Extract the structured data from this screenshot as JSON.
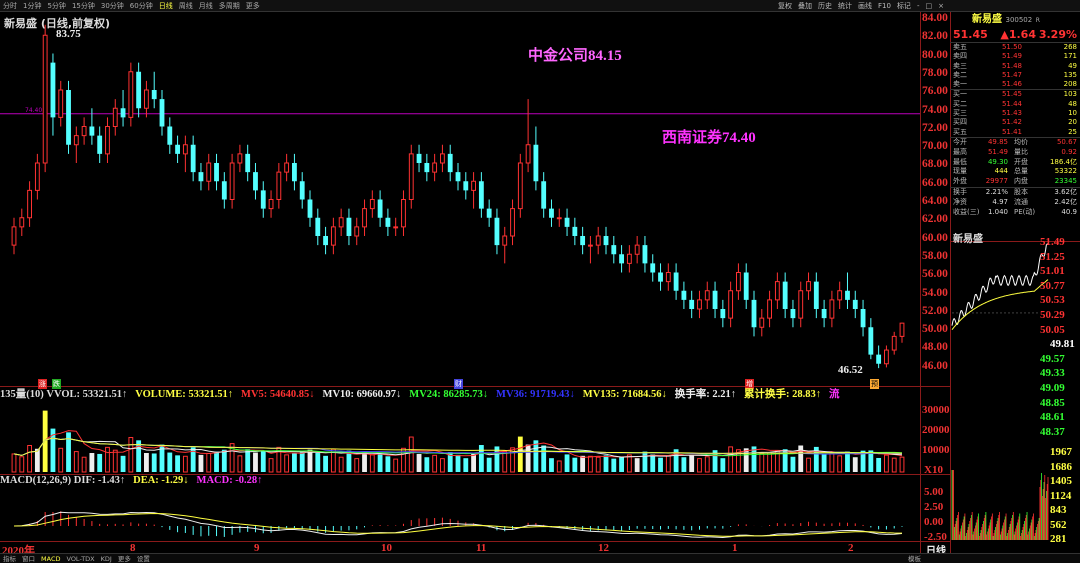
{
  "topbar": {
    "tabs": [
      "分时",
      "1分钟",
      "5分钟",
      "15分钟",
      "30分钟",
      "60分钟",
      "日线",
      "周线",
      "月线",
      "多周期",
      "更多"
    ],
    "active_tab": "日线",
    "right_buttons": [
      "复权",
      "叠加",
      "历史",
      "统计",
      "画线",
      "F10",
      "标记",
      "-",
      "□",
      "×"
    ]
  },
  "kline": {
    "title": "新易盛 (日线,前复权)",
    "high_label": "83.75",
    "low_label": "46.52",
    "ref_line_label": "74.40",
    "annotation1": "中金公司84.15",
    "annotation2": "西南证券74.40",
    "yaxis": [
      "84.00",
      "82.00",
      "80.00",
      "78.00",
      "76.00",
      "74.00",
      "72.00",
      "70.00",
      "68.00",
      "66.00",
      "64.00",
      "62.00",
      "60.00",
      "58.00",
      "56.00",
      "54.00",
      "52.00",
      "50.00",
      "48.00",
      "46.00"
    ]
  },
  "volume": {
    "markers": [
      "涨",
      "跌",
      "财",
      "增",
      "预"
    ],
    "header": [
      {
        "t": "135量(10) VVOL: 53321.51↑",
        "c": "#ddd"
      },
      {
        "t": "VOLUME: 53321.51↑",
        "c": "#ff4"
      },
      {
        "t": "MV5: 54640.85↓",
        "c": "#f33"
      },
      {
        "t": "MV10: 69660.97↓",
        "c": "#eee"
      },
      {
        "t": "MV24: 86285.73↓",
        "c": "#3f3"
      },
      {
        "t": "MV36: 91719.43↓",
        "c": "#33f"
      },
      {
        "t": "MV135: 71684.56↓",
        "c": "#ff4"
      },
      {
        "t": "换手率: 2.21↑",
        "c": "#eee"
      },
      {
        "t": "累计换手: 28.83↑",
        "c": "#ff4"
      },
      {
        "t": "流",
        "c": "#f3f"
      }
    ],
    "yaxis": [
      "30000",
      "20000",
      "10000",
      "X10"
    ]
  },
  "macd": {
    "header": [
      {
        "t": "MACD(12,26,9) DIF: -1.43↑",
        "c": "#ddd"
      },
      {
        "t": "DEA: -1.29↓",
        "c": "#ff4"
      },
      {
        "t": "MACD: -0.28↑",
        "c": "#f3f"
      }
    ],
    "yaxis": [
      "5.00",
      "2.50",
      "0.00",
      "-2.50"
    ]
  },
  "xaxis": {
    "labels": [
      "2020年",
      "8",
      "9",
      "10",
      "11",
      "12",
      "1",
      "2"
    ],
    "corner_label": "日线"
  },
  "bottombar": [
    "指标",
    "窗口",
    "MACD",
    "VOL-TDX",
    "KDJ",
    "更多",
    "设置",
    "模板"
  ],
  "quote": {
    "name": "新易盛",
    "code": "300502",
    "code_suffix": "R",
    "price": "51.45",
    "change": "▲1.64",
    "pct": "3.29%",
    "asks": [
      {
        "l": "卖五",
        "p": "51.50",
        "v": "268"
      },
      {
        "l": "卖四",
        "p": "51.49",
        "v": "171"
      },
      {
        "l": "卖三",
        "p": "51.48",
        "v": "49"
      },
      {
        "l": "卖二",
        "p": "51.47",
        "v": "135"
      },
      {
        "l": "卖一",
        "p": "51.46",
        "v": "208"
      }
    ],
    "bids": [
      {
        "l": "买一",
        "p": "51.45",
        "v": "103"
      },
      {
        "l": "买二",
        "p": "51.44",
        "v": "48"
      },
      {
        "l": "买三",
        "p": "51.43",
        "v": "10"
      },
      {
        "l": "买四",
        "p": "51.42",
        "v": "20"
      },
      {
        "l": "买五",
        "p": "51.41",
        "v": "25"
      }
    ],
    "stats": [
      [
        "今开",
        "49.85",
        "均价",
        "50.67"
      ],
      [
        "最高",
        "51.49",
        "量比",
        "0.92"
      ],
      [
        "最低",
        "49.30",
        "开盘",
        "186.4亿"
      ],
      [
        "现量",
        "444",
        "总量",
        "53322"
      ],
      [
        "外盘",
        "29977",
        "内盘",
        "23345"
      ]
    ],
    "stats2": [
      [
        "换手",
        "2.21%",
        "股本",
        "3.62亿"
      ],
      [
        "净资",
        "4.97",
        "流通",
        "2.42亿"
      ],
      [
        "收益(三)",
        "1.040",
        "PE(动)",
        "40.9"
      ]
    ]
  },
  "intraday": {
    "name": "新易盛",
    "yaxis_up": [
      "51.49",
      "51.25",
      "51.01",
      "50.77",
      "50.53",
      "50.29",
      "50.05"
    ],
    "base": "49.81",
    "yaxis_down": [
      "49.57",
      "49.33",
      "49.09",
      "48.85",
      "48.61",
      "48.37"
    ],
    "vol_axis": [
      "1967",
      "1686",
      "1405",
      "1124",
      "843",
      "562",
      "281"
    ]
  },
  "chart_data": {
    "type": "candlestick",
    "ylim": [
      45,
      85
    ],
    "candles": [
      [
        60,
        63,
        59,
        62
      ],
      [
        62,
        64,
        61,
        63
      ],
      [
        63,
        67,
        62,
        66
      ],
      [
        66,
        70,
        65,
        69
      ],
      [
        69,
        84.15,
        68,
        83
      ],
      [
        80,
        81,
        72,
        74
      ],
      [
        74,
        78,
        73,
        77
      ],
      [
        77,
        78,
        70,
        71
      ],
      [
        71,
        73,
        69,
        72
      ],
      [
        72,
        74,
        71,
        73
      ],
      [
        73,
        75,
        71,
        72
      ],
      [
        72,
        73,
        69,
        70
      ],
      [
        70,
        74,
        69,
        73
      ],
      [
        73,
        76,
        72,
        75
      ],
      [
        75,
        77,
        73,
        74
      ],
      [
        74,
        80,
        73,
        79
      ],
      [
        79,
        80,
        74,
        75
      ],
      [
        75,
        78,
        74,
        77
      ],
      [
        77,
        79,
        75,
        76
      ],
      [
        76,
        77,
        72,
        73
      ],
      [
        73,
        74,
        70,
        71
      ],
      [
        71,
        72,
        69,
        70
      ],
      [
        70,
        72,
        68,
        71
      ],
      [
        71,
        72,
        67,
        68
      ],
      [
        68,
        69,
        66,
        67
      ],
      [
        67,
        70,
        66,
        69
      ],
      [
        69,
        70,
        66,
        67
      ],
      [
        67,
        68,
        64,
        65
      ],
      [
        65,
        70,
        64,
        69
      ],
      [
        69,
        71,
        68,
        70
      ],
      [
        70,
        71,
        67,
        68
      ],
      [
        68,
        69,
        65,
        66
      ],
      [
        66,
        67,
        63,
        64
      ],
      [
        64,
        66,
        63,
        65
      ],
      [
        65,
        69,
        64,
        68
      ],
      [
        68,
        70,
        67,
        69
      ],
      [
        69,
        70,
        66,
        67
      ],
      [
        67,
        68,
        64,
        65
      ],
      [
        65,
        66,
        62,
        63
      ],
      [
        63,
        64,
        60,
        61
      ],
      [
        61,
        62,
        59,
        60
      ],
      [
        60,
        63,
        59,
        62
      ],
      [
        62,
        64,
        61,
        63
      ],
      [
        63,
        64,
        60,
        61
      ],
      [
        61,
        63,
        60,
        62
      ],
      [
        62,
        65,
        61,
        64
      ],
      [
        64,
        66,
        63,
        65
      ],
      [
        65,
        66,
        62,
        63
      ],
      [
        63,
        64,
        61,
        62
      ],
      [
        62,
        63,
        61,
        62
      ],
      [
        62,
        66,
        61,
        65
      ],
      [
        65,
        71,
        64,
        70
      ],
      [
        70,
        71,
        68,
        69
      ],
      [
        69,
        70,
        67,
        68
      ],
      [
        68,
        70,
        67,
        69
      ],
      [
        69,
        71,
        68,
        70
      ],
      [
        70,
        71,
        67,
        68
      ],
      [
        68,
        69,
        66,
        67
      ],
      [
        67,
        68,
        65,
        66
      ],
      [
        66,
        68,
        64,
        67
      ],
      [
        67,
        68,
        63,
        64
      ],
      [
        64,
        65,
        62,
        63
      ],
      [
        63,
        64,
        59,
        60
      ],
      [
        60,
        62,
        58,
        61
      ],
      [
        61,
        65,
        60,
        64
      ],
      [
        64,
        70,
        63,
        69
      ],
      [
        69,
        76,
        68,
        71
      ],
      [
        71,
        73,
        66,
        67
      ],
      [
        67,
        68,
        63,
        64
      ],
      [
        64,
        65,
        62,
        63
      ],
      [
        63,
        64,
        62,
        63
      ],
      [
        63,
        64,
        61,
        62
      ],
      [
        62,
        63,
        60,
        61
      ],
      [
        61,
        62,
        59,
        60
      ],
      [
        60,
        61,
        58,
        60
      ],
      [
        60,
        62,
        59,
        61
      ],
      [
        61,
        62,
        59,
        60
      ],
      [
        60,
        61,
        58,
        59
      ],
      [
        59,
        60,
        57,
        58
      ],
      [
        58,
        60,
        57,
        59
      ],
      [
        59,
        61,
        58,
        60
      ],
      [
        60,
        61,
        57,
        58
      ],
      [
        58,
        59,
        56,
        57
      ],
      [
        57,
        58,
        55,
        56
      ],
      [
        56,
        58,
        55,
        57
      ],
      [
        57,
        58,
        54,
        55
      ],
      [
        55,
        56,
        53,
        54
      ],
      [
        54,
        55,
        52,
        53
      ],
      [
        53,
        55,
        52,
        54
      ],
      [
        54,
        56,
        53,
        55
      ],
      [
        55,
        56,
        52,
        53
      ],
      [
        53,
        54,
        51,
        52
      ],
      [
        52,
        56,
        51,
        55
      ],
      [
        55,
        58,
        54,
        57
      ],
      [
        57,
        58,
        53,
        54
      ],
      [
        54,
        55,
        50,
        51
      ],
      [
        51,
        53,
        50,
        52
      ],
      [
        52,
        55,
        51,
        54
      ],
      [
        54,
        57,
        53,
        56
      ],
      [
        56,
        57,
        52,
        53
      ],
      [
        53,
        54,
        51,
        52
      ],
      [
        52,
        56,
        51,
        55
      ],
      [
        55,
        57,
        54,
        56
      ],
      [
        56,
        57,
        52,
        53
      ],
      [
        53,
        54,
        51,
        52
      ],
      [
        52,
        55,
        51,
        54
      ],
      [
        54,
        56,
        53,
        55
      ],
      [
        55,
        57,
        53,
        54
      ],
      [
        54,
        55,
        52,
        53
      ],
      [
        53,
        54,
        50,
        51
      ],
      [
        51,
        52,
        47.5,
        48
      ],
      [
        48,
        49,
        46.52,
        47
      ],
      [
        47,
        49,
        46.6,
        48.5
      ],
      [
        48.5,
        50.5,
        48,
        50
      ],
      [
        50,
        51.49,
        49.3,
        51.45
      ]
    ],
    "ref_line": 74.4
  }
}
